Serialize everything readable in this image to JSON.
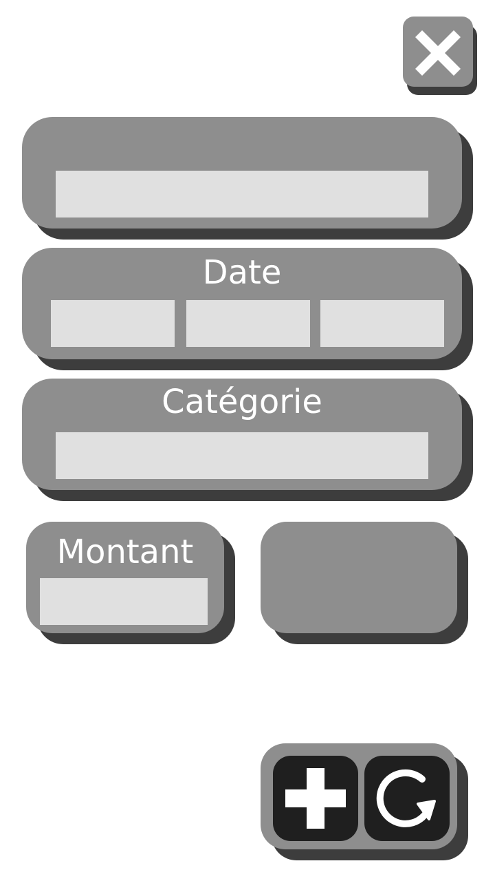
{
  "window": {
    "close_icon": "close-icon"
  },
  "form": {
    "name": {
      "value": "",
      "placeholder": ""
    },
    "date": {
      "label": "Date",
      "day": "",
      "month": "",
      "year": ""
    },
    "category": {
      "label": "Catégorie",
      "value": ""
    },
    "amount": {
      "label": "Montant",
      "value": ""
    }
  },
  "actions": {
    "add_icon": "plus-icon",
    "reset_icon": "refresh-icon"
  },
  "colors": {
    "panel": "#8e8e8e",
    "panel_shadow": "#3d3d3d",
    "field": "#e0e0e0",
    "button_dark": "#1f1f1f",
    "text": "#ffffff"
  }
}
